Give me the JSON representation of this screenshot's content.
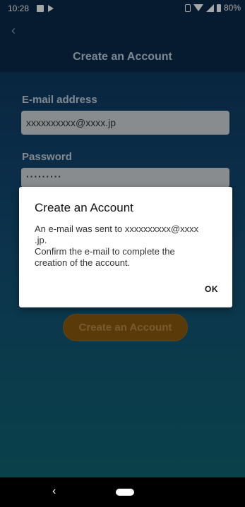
{
  "status_bar": {
    "time": "10:28",
    "battery": "80%"
  },
  "app_bar": {
    "title": "Create an Account",
    "back_glyph": "‹"
  },
  "form": {
    "email_label": "E-mail address",
    "email_value": "xxxxxxxxxx@xxxx.jp",
    "password_label": "Password",
    "password_value": "·········",
    "submit_label": "Create an Account"
  },
  "dialog": {
    "title": "Create an Account",
    "message_line1": "An e-mail was sent to xxxxxxxxxx@xxxx",
    "message_line2": ".jp.",
    "message_line3": "Confirm the e-mail to complete the",
    "message_line4": "creation of the account.",
    "ok_label": "OK"
  },
  "nav_bar": {
    "back_glyph": "‹"
  },
  "colors": {
    "header": "#0b2a4a",
    "button": "#8a5a0f",
    "dialog_bg": "#ffffff"
  },
  "icons": [
    "image-icon",
    "play-store-icon",
    "vibrate-icon",
    "wifi-icon",
    "signal-icon",
    "battery-icon",
    "back-icon",
    "home-pill-icon"
  ]
}
